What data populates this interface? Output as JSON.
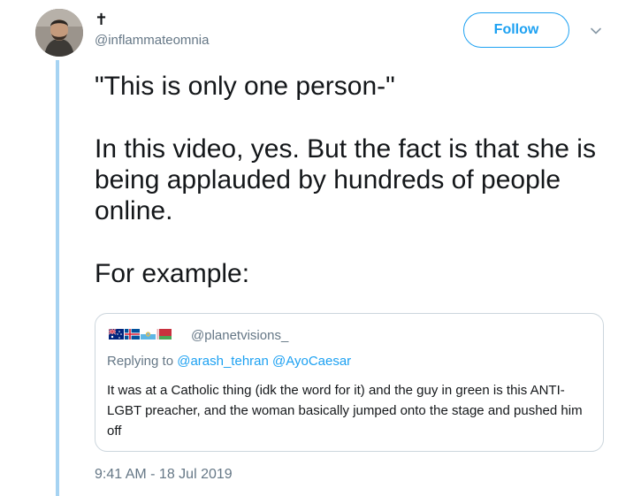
{
  "author": {
    "display_name": "✝",
    "handle": "@inflammateomnia"
  },
  "follow_label": "Follow",
  "tweet": {
    "paragraphs": [
      "\"This is only one person-\"",
      "In this video, yes. But the fact is that she is being applauded by hundreds of people online.",
      "For example:"
    ]
  },
  "quoted_tweet": {
    "flags": [
      "australia-flag",
      "iceland-flag",
      "san-marino-flag",
      "belarus-flag"
    ],
    "handle": "@planetvisions_",
    "replying_to_prefix": "Replying to",
    "replying_to_1": "@arash_tehran",
    "replying_to_2": "@AyoCaesar",
    "text": "It was at a Catholic thing (idk the word for it) and the guy in green is this ANTI-LGBT preacher, and the woman basically jumped onto the stage and pushed him off"
  },
  "timestamp": "9:41 AM - 18 Jul 2019",
  "colors": {
    "accent": "#1da1f2",
    "thread_line": "#a6d3f2",
    "muted_text": "#657786",
    "border": "#ccd6dd"
  }
}
